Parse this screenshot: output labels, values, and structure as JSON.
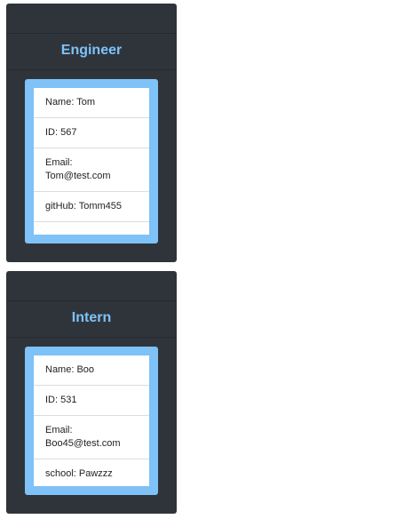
{
  "cards": [
    {
      "role": "Engineer",
      "fields": [
        {
          "text": "Name: Tom"
        },
        {
          "text": "ID: 567"
        },
        {
          "text": "Email: Tom@test.com"
        },
        {
          "text": "gitHub: Tomm455"
        }
      ]
    },
    {
      "role": "Intern",
      "fields": [
        {
          "text": "Name: Boo"
        },
        {
          "text": "ID: 531"
        },
        {
          "text": "Email: Boo45@test.com"
        },
        {
          "text": "school: Pawzzz"
        }
      ]
    }
  ],
  "colors": {
    "card_bg": "#2f343b",
    "accent": "#7ec2f8",
    "list_bg": "#ffffff"
  }
}
